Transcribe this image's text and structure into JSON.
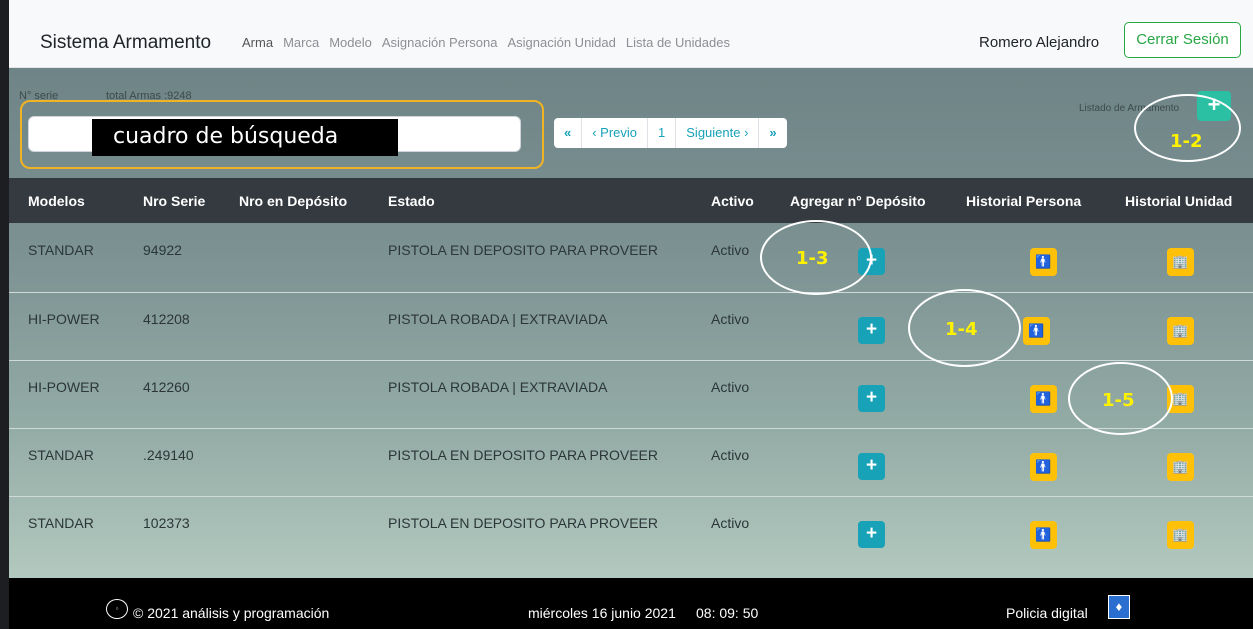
{
  "navbar": {
    "brand": "Sistema Armamento",
    "links": [
      "Arma",
      "Marca",
      "Modelo",
      "Asignación Persona",
      "Asignación Unidad",
      "Lista de Unidades"
    ],
    "user": "Romero Alejandro",
    "logout": "Cerrar Sesión"
  },
  "toolbar": {
    "serie_label": "N° serie",
    "total_label": "total Armas :9248",
    "search_annotation": "cuadro de búsqueda",
    "pager": {
      "first": "«",
      "prev": "‹ Previo",
      "page": "1",
      "next": "Siguiente ›",
      "last": "»"
    },
    "listado_label": "Listado de Armamento",
    "add_label": "+"
  },
  "annotations": [
    "1-2",
    "1-3",
    "1-4",
    "1-5"
  ],
  "table": {
    "headers": [
      "Modelos",
      "Nro Serie",
      "Nro en Depósito",
      "Estado",
      "Activo",
      "Agregar n° Depósito",
      "Historial Persona",
      "Historial Unidad"
    ],
    "rows": [
      {
        "modelo": "STANDAR",
        "serie": "94922",
        "deposito": "",
        "estado": "PISTOLA EN DEPOSITO PARA PROVEER",
        "activo": "Activo"
      },
      {
        "modelo": "HI-POWER",
        "serie": "412208",
        "deposito": "",
        "estado": "PISTOLA ROBADA | EXTRAVIADA",
        "activo": "Activo"
      },
      {
        "modelo": "HI-POWER",
        "serie": "412260",
        "deposito": "",
        "estado": "PISTOLA ROBADA | EXTRAVIADA",
        "activo": "Activo"
      },
      {
        "modelo": "STANDAR",
        "serie": ".249140",
        "deposito": "",
        "estado": "PISTOLA EN DEPOSITO PARA PROVEER",
        "activo": "Activo"
      },
      {
        "modelo": "STANDAR",
        "serie": "102373",
        "deposito": "",
        "estado": "PISTOLA EN DEPOSITO PARA PROVEER",
        "activo": "Activo"
      }
    ],
    "add_glyph": "+",
    "person_glyph": "🚹",
    "unit_glyph": "🏢"
  },
  "footer": {
    "copyright": "© 2021 análisis y programación",
    "date": "miércoles 16 junio 2021",
    "time": "08: 09: 50",
    "brand": "Policia digital"
  },
  "colors": {
    "teal_button": "#17a2b8",
    "yellow_button": "#ffc107",
    "green_outline": "#28a745",
    "annotation_yellow": "#fff200",
    "search_outline": "#f0b323"
  }
}
